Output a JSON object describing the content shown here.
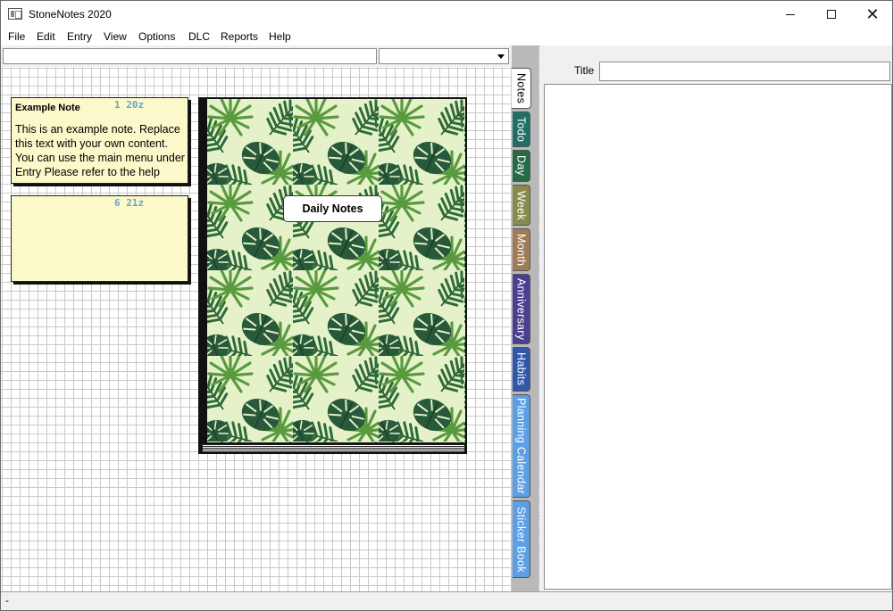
{
  "window": {
    "title": "StoneNotes 2020"
  },
  "menu": [
    "File",
    "Edit",
    "Entry",
    "View",
    "Options",
    "DLC",
    "Reports",
    "Help"
  ],
  "search": {
    "value": ""
  },
  "filter": {
    "selected": ""
  },
  "notes": [
    {
      "title": "Example Note",
      "meta": "1 20z",
      "body": "This is an example note. Replace this text with your own content. You can use the main menu under Entry Please refer to the help"
    },
    {
      "title": "",
      "meta": "6 21z",
      "body": ""
    }
  ],
  "notebook": {
    "label": "Daily Notes"
  },
  "tabs": [
    {
      "label": "Notes",
      "color": "#ffffff",
      "active": true
    },
    {
      "label": "Todo",
      "color": "#1e6f66"
    },
    {
      "label": "Day",
      "color": "#256b46"
    },
    {
      "label": "Week",
      "color": "#888a4f"
    },
    {
      "label": "Month",
      "color": "#a07c56"
    },
    {
      "label": "Anniversary",
      "color": "#4c3f8f"
    },
    {
      "label": "Habits",
      "color": "#3158a8"
    },
    {
      "label": "Planning Calendar",
      "color": "#5c9fe6"
    },
    {
      "label": "Sticker Book",
      "color": "#5c9fe6"
    }
  ],
  "detail": {
    "title_label": "Title",
    "title_value": ""
  },
  "status": {
    "text": "-"
  }
}
